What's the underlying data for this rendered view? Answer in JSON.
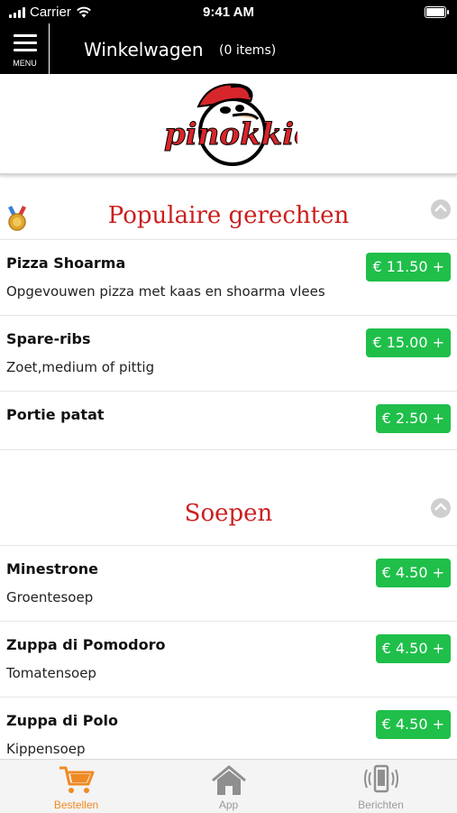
{
  "status_bar": {
    "carrier": "Carrier",
    "time": "9:41 AM"
  },
  "header": {
    "menu_label": "MENU",
    "title": "Winkelwagen",
    "item_count": "(0 items)"
  },
  "logo": {
    "text": "pinokkio",
    "alt": "Pinokkio logo"
  },
  "sections": [
    {
      "title": "Populaire gerechten",
      "items": [
        {
          "name": "Pizza Shoarma",
          "description": "Opgevouwen pizza met kaas en shoarma vlees",
          "price": "€ 11.50 +"
        },
        {
          "name": "Spare-ribs",
          "description": "Zoet,medium of pittig",
          "price": "€ 15.00 +"
        },
        {
          "name": "Portie patat",
          "description": "",
          "price": "€ 2.50 +"
        }
      ]
    },
    {
      "title": "Soepen",
      "items": [
        {
          "name": "Minestrone",
          "description": "Groentesoep",
          "price": "€ 4.50 +"
        },
        {
          "name": "Zuppa di Pomodoro",
          "description": "Tomatensoep",
          "price": "€ 4.50 +"
        },
        {
          "name": "Zuppa di Polo",
          "description": "Kippensoep",
          "price": "€ 4.50 +"
        }
      ]
    }
  ],
  "tabs": [
    {
      "label": "Bestellen",
      "icon": "cart-icon",
      "active": true
    },
    {
      "label": "App",
      "icon": "home-icon",
      "active": false
    },
    {
      "label": "Berichten",
      "icon": "phone-vibrate-icon",
      "active": false
    }
  ],
  "colors": {
    "accent_red": "#cc1e1e",
    "price_green": "#1fbf4a",
    "tab_active": "#f08a24",
    "header_bg": "#000000"
  }
}
